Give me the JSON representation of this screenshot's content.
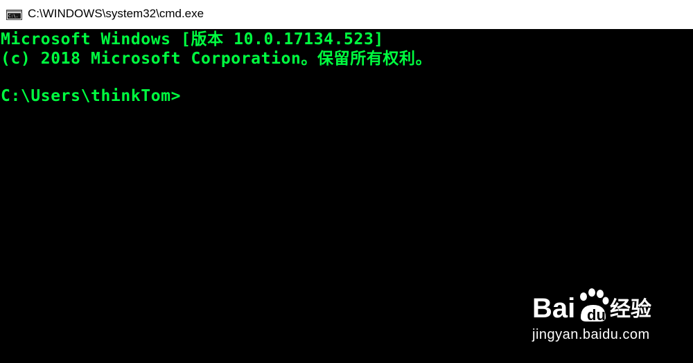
{
  "window": {
    "title": "C:\\WINDOWS\\system32\\cmd.exe",
    "icon": "cmd-icon",
    "icon_text": "C:\\."
  },
  "console": {
    "lines": [
      "Microsoft Windows [版本 10.0.17134.523]",
      "(c) 2018 Microsoft Corporation。保留所有权利。",
      "C:\\Users\\thinkTom>"
    ],
    "text_color": "#00ff40",
    "background_color": "#000000"
  },
  "watermark": {
    "brand": "Bai du 经验",
    "url": "jingyan.baidu.com"
  }
}
